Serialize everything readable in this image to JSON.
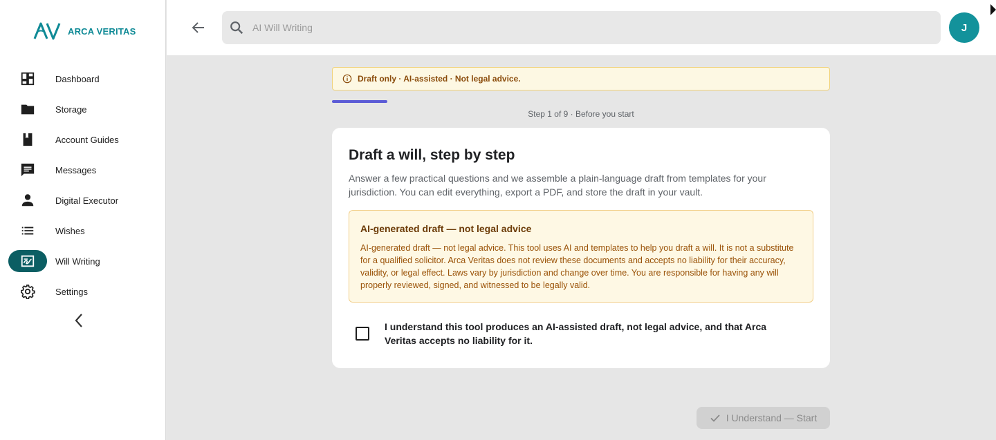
{
  "brand": {
    "name": "ARCA VERITAS",
    "accent": "#0f8a96"
  },
  "sidebar": {
    "items": [
      {
        "label": "Dashboard",
        "icon": "dashboard-icon",
        "active": false
      },
      {
        "label": "Storage",
        "icon": "folder-icon",
        "active": false
      },
      {
        "label": "Account Guides",
        "icon": "book-icon",
        "active": false
      },
      {
        "label": "Messages",
        "icon": "chat-icon",
        "active": false
      },
      {
        "label": "Digital Executor",
        "icon": "person-icon",
        "active": false
      },
      {
        "label": "Wishes",
        "icon": "list-icon",
        "active": false
      },
      {
        "label": "Will Writing",
        "icon": "signature-icon",
        "active": true
      },
      {
        "label": "Settings",
        "icon": "gear-icon",
        "active": false
      }
    ],
    "collapse_icon": "chevron-left-icon"
  },
  "topbar": {
    "back_icon": "arrow-left-icon",
    "search": {
      "placeholder": "AI Will Writing",
      "value": ""
    },
    "avatar_initial": "J"
  },
  "banner": {
    "text": "Draft only · AI-assisted · Not legal advice."
  },
  "progress": {
    "current_step": 1,
    "total_steps": 9,
    "fraction": 0.111,
    "step_text": "Step 1 of 9 · Before you start"
  },
  "card": {
    "title": "Draft a will, step by step",
    "description": "Answer a few practical questions and we assemble a plain-language draft from templates for your jurisdiction. You can edit everything, export a PDF, and store the draft in your vault.",
    "warning_title": "AI-generated draft — not legal advice",
    "warning_body": "AI-generated draft — not legal advice. This tool uses AI and templates to help you draft a will. It is not a substitute for a qualified solicitor. Arca Veritas does not review these documents and accepts no liability for their accuracy, validity, or legal effect. Laws vary by jurisdiction and change over time. You are responsible for having any will properly reviewed, signed, and witnessed to be legally valid.",
    "acknowledge_text": "I understand this tool produces an AI-assisted draft, not legal advice, and that Arca Veritas accepts no liability for it.",
    "acknowledge_checked": false
  },
  "actions": {
    "start_label": "I Understand — Start",
    "start_enabled": false
  },
  "colors": {
    "active_nav": "#0b5e63",
    "progress": "#5b5bd6",
    "avatar": "#13929b",
    "banner_bg": "#fdf8e3"
  }
}
